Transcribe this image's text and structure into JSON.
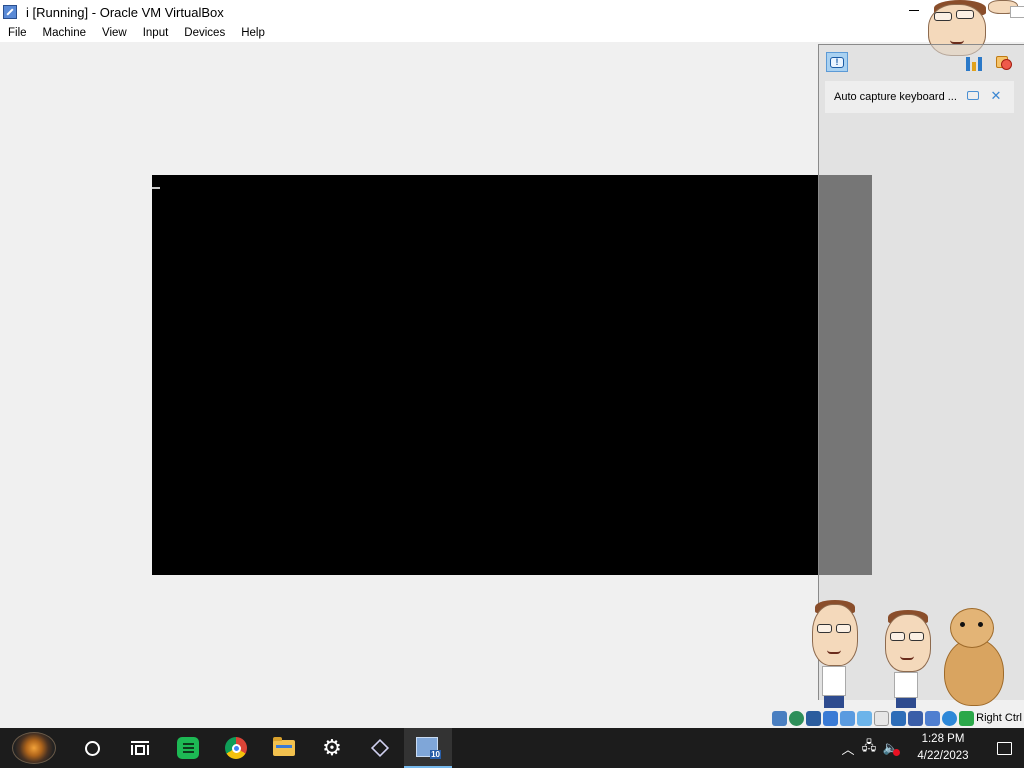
{
  "window": {
    "title": "i [Running] - Oracle VM VirtualBox"
  },
  "menu": {
    "items": [
      "File",
      "Machine",
      "View",
      "Input",
      "Devices",
      "Help"
    ]
  },
  "notification_center": {
    "toggle_icon": "exclamation-bubble-icon",
    "sort_icon": "sort-icon",
    "clear_icon": "clear-all-icon",
    "messages": [
      {
        "text": "Auto capture keyboard ...",
        "help_icon": "help-icon",
        "close_icon": "close-icon"
      }
    ]
  },
  "statusbar": {
    "host_key": "Right Ctrl",
    "icons": [
      "hard-disk-icon",
      "optical-drive-icon",
      "floppy-icon",
      "audio-icon",
      "network-icon",
      "usb-icon",
      "shared-folders-icon",
      "display-icon",
      "recording-icon",
      "cpu-icon",
      "mouse-integration-icon",
      "keyboard-icon"
    ]
  },
  "taskbar": {
    "apps": [
      "start-orb-icon",
      "cortana-icon",
      "task-view-icon",
      "notes-app-icon",
      "chrome-icon",
      "file-explorer-icon",
      "settings-gear-icon",
      "virtualbox-icon",
      "vm-window-icon"
    ],
    "tray": {
      "time": "1:28 PM",
      "date": "4/22/2023"
    }
  },
  "colors": {
    "taskbar": "#1c1c1c",
    "vm_screen": "#000000",
    "active_accent": "#76b9ed"
  }
}
